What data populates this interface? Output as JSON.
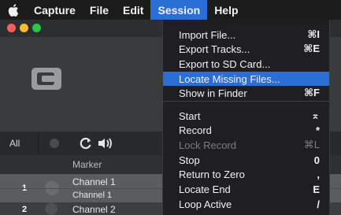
{
  "menubar": {
    "apple": "apple-logo",
    "items": [
      "Capture",
      "File",
      "Edit",
      "Session",
      "Help"
    ],
    "active": "Session"
  },
  "window": {
    "traffic_lights": [
      "#ff5f57",
      "#febc2e",
      "#28c840"
    ],
    "tabs": {
      "all": "All"
    },
    "column_header": "Marker",
    "rows": [
      {
        "number": "1",
        "name": "Channel 1",
        "sub": "Channel 1"
      },
      {
        "number": "2",
        "name": "Channel 2"
      }
    ]
  },
  "session_menu": {
    "items": [
      {
        "label": "Import File...",
        "shortcut": "⌘I"
      },
      {
        "label": "Export Tracks...",
        "shortcut": "⌘E"
      },
      {
        "label": "Export to SD Card...",
        "shortcut": ""
      },
      {
        "label": "Locate Missing Files...",
        "shortcut": "",
        "highlighted": true
      },
      {
        "label": "Show in Finder",
        "shortcut": "⌘F"
      },
      {
        "label": "Start",
        "shortcut": "⌅"
      },
      {
        "label": "Record",
        "shortcut": "*"
      },
      {
        "label": "Lock Record",
        "shortcut": "⌘L",
        "disabled": true
      },
      {
        "label": "Stop",
        "shortcut": "0"
      },
      {
        "label": "Return to Zero",
        "shortcut": ","
      },
      {
        "label": "Locate End",
        "shortcut": "E"
      },
      {
        "label": "Loop Active",
        "shortcut": "/"
      }
    ]
  },
  "colors": {
    "menubar_bg": "#1b1b1c",
    "accent": "#2a6fd6",
    "menu_bg": "#1f1f21",
    "disabled_text": "#7c7c7e"
  }
}
